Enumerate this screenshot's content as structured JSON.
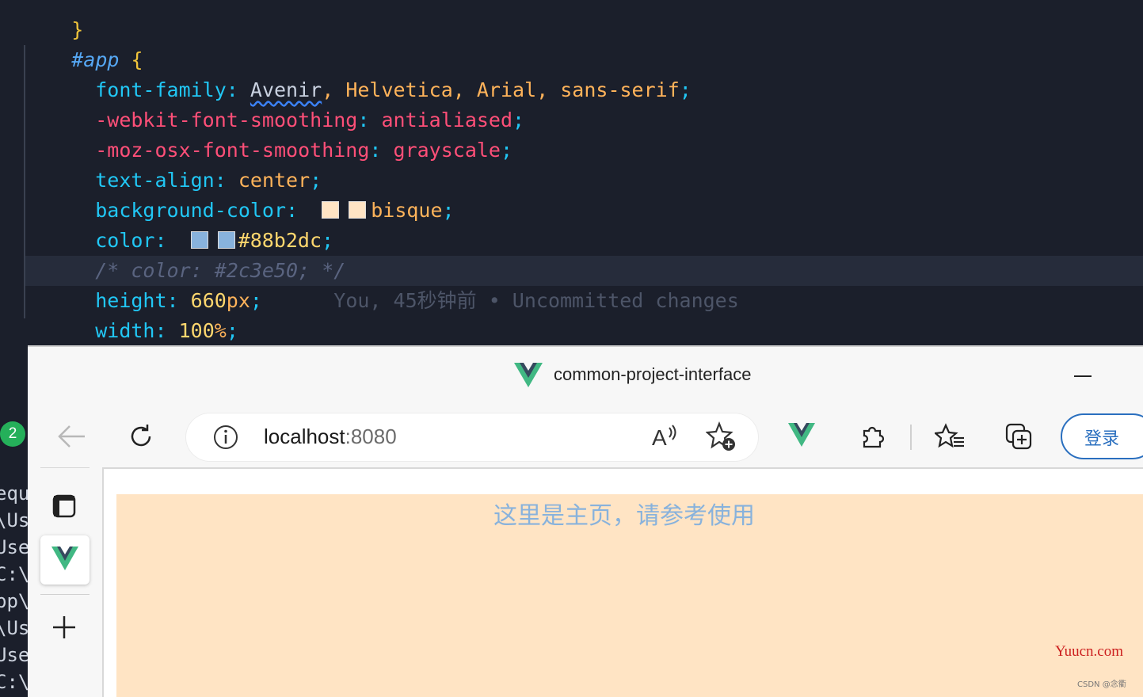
{
  "editor": {
    "lines": {
      "l0": {
        "brace": "}"
      },
      "l1": {
        "selector": "#app",
        "brace": "{"
      },
      "l2": {
        "prop": "font-family",
        "colon": ": ",
        "val1": "Avenir",
        "rest": ", Helvetica, Arial, sans-serif",
        "semi": ";"
      },
      "l3": {
        "prop": "-webkit-font-smoothing",
        "colon": ": ",
        "val": "antialiased",
        "semi": ";"
      },
      "l4": {
        "prop": "-moz-osx-font-smoothing",
        "colon": ": ",
        "val": "grayscale",
        "semi": ";"
      },
      "l5": {
        "prop": "text-align",
        "colon": ": ",
        "val": "center",
        "semi": ";"
      },
      "l6": {
        "prop": "background-color",
        "colon": ": ",
        "val": "bisque",
        "semi": ";"
      },
      "l7": {
        "prop": "color",
        "colon": ": ",
        "val": "#88b2dc",
        "semi": ";"
      },
      "l8": {
        "comment": "/* color: #2c3e50; */"
      },
      "l9": {
        "prop": "height",
        "colon": ": ",
        "num": "660",
        "unit": "px",
        "semi": ";",
        "blame": "You, 45秒钟前 • Uncommitted changes"
      },
      "l10": {
        "prop": "width",
        "colon": ": ",
        "num": "100",
        "unit": "%",
        "semi": ";"
      },
      "l11": {
        "brace": "}"
      }
    },
    "swatch_colors": {
      "bisque": "#ffe4c4",
      "blue": "#88b2dc"
    }
  },
  "terminal": {
    "badge": "2",
    "lines": [
      "equ",
      "\\Us",
      "Use",
      "C:\\",
      "pp\\",
      "\\Us",
      "Use",
      "C:\\"
    ]
  },
  "browser": {
    "title": "common-project-interface",
    "address": {
      "host": "localhost",
      "port": ":8080"
    },
    "login": "登录",
    "content_text": "这里是主页，请参考使用",
    "bg_color": "#ffe4c4",
    "text_color": "#88b2dc"
  },
  "watermarks": {
    "site": "Yuucn.com",
    "csdn": "CSDN @念衢"
  }
}
